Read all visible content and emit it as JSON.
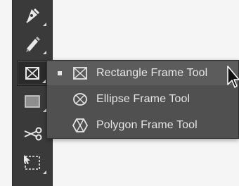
{
  "toolbar": {
    "tools": [
      {
        "name": "pen-tool",
        "icon": "pen-icon",
        "has_flyout": true
      },
      {
        "name": "pencil-tool",
        "icon": "pencil-icon",
        "has_flyout": true
      },
      {
        "name": "rectangle-frame-tool",
        "icon": "rectangle-frame-icon",
        "has_flyout": true,
        "active": true
      },
      {
        "name": "rectangle-tool",
        "icon": "rectangle-icon",
        "has_flyout": true
      },
      {
        "name": "scissors-tool",
        "icon": "scissors-icon",
        "has_flyout": false
      },
      {
        "name": "free-transform-tool",
        "icon": "free-transform-icon",
        "has_flyout": true
      }
    ]
  },
  "flyout": {
    "items": [
      {
        "label": "Rectangle Frame Tool",
        "icon": "rectangle-frame-icon",
        "selected": true
      },
      {
        "label": "Ellipse Frame Tool",
        "icon": "ellipse-frame-icon",
        "selected": false
      },
      {
        "label": "Polygon Frame Tool",
        "icon": "polygon-frame-icon",
        "selected": false
      }
    ]
  },
  "colors": {
    "toolbar_bg": "#3a3a3a",
    "flyout_bg": "#505050",
    "selected_bg": "#5c5c5c",
    "text": "#e6e6e6"
  }
}
